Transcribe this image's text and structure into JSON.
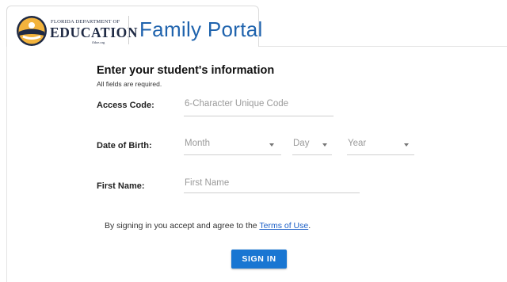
{
  "header": {
    "logo_line1": "FLORIDA DEPARTMENT OF",
    "logo_line2": "EDUCATION",
    "logo_line3": "fldoe.org",
    "portal_title": "Family Portal"
  },
  "form": {
    "heading": "Enter your student's information",
    "note": "All fields are required.",
    "access_code": {
      "label": "Access Code:",
      "placeholder": "6-Character Unique Code"
    },
    "dob": {
      "label": "Date of Birth:",
      "month_placeholder": "Month",
      "day_placeholder": "Day",
      "year_placeholder": "Year"
    },
    "first_name": {
      "label": "First Name:",
      "placeholder": "First Name"
    },
    "terms_prefix": "By signing in you accept and agree to the ",
    "terms_link": "Terms of Use",
    "terms_suffix": ".",
    "signin_label": "SIGN IN"
  },
  "colors": {
    "brand_blue": "#1f63ad",
    "button_blue": "#1976d2",
    "link_blue": "#1c5fc7"
  }
}
